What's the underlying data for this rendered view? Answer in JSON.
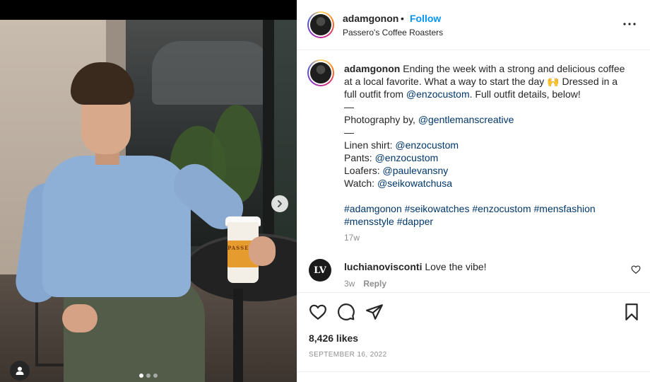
{
  "post": {
    "username": "adamgonon",
    "separator": "•",
    "follow_label": "Follow",
    "location": "Passero's Coffee Roasters",
    "more_icon": "more-options-icon"
  },
  "caption": {
    "username": "adamgonon",
    "line1": "Ending the week with a strong and delicious coffee",
    "line2a": "at a local favorite. What a way to start the day ",
    "emoji": "🙌",
    "line2b": " Dressed in a",
    "line3a": "full outfit from ",
    "line3_mention": "@enzocustom",
    "line3b": ". Full outfit details, below!",
    "dash1": "—",
    "photo_label": "Photography by, ",
    "photo_mention": "@gentlemanscreative",
    "dash2": "—",
    "shirt_label": "Linen shirt: ",
    "shirt_mention": "@enzocustom",
    "pants_label": "Pants: ",
    "pants_mention": "@enzocustom",
    "loafers_label": "Loafers: ",
    "loafers_mention": "@paulevansny",
    "watch_label": "Watch: ",
    "watch_mention": "@seikowatchusa",
    "hashtags1": "#adamgonon #seikowatches #enzocustom #mensfashion",
    "hashtags2": "#mensstyle #dapper",
    "time": "17w"
  },
  "comment": {
    "avatar_text": "LV",
    "username": "luchianovisconti",
    "text": "Love the vibe!",
    "time": "3w",
    "reply_label": "Reply"
  },
  "photo": {
    "cup_text": "PASSERO",
    "carousel_dots": 3,
    "active_dot": 1
  },
  "engagement": {
    "likes": "8,426 likes",
    "date": "SEPTEMBER 16, 2022"
  },
  "colors": {
    "link": "#00376b",
    "follow": "#0095f6",
    "muted": "#8e8e8e"
  }
}
